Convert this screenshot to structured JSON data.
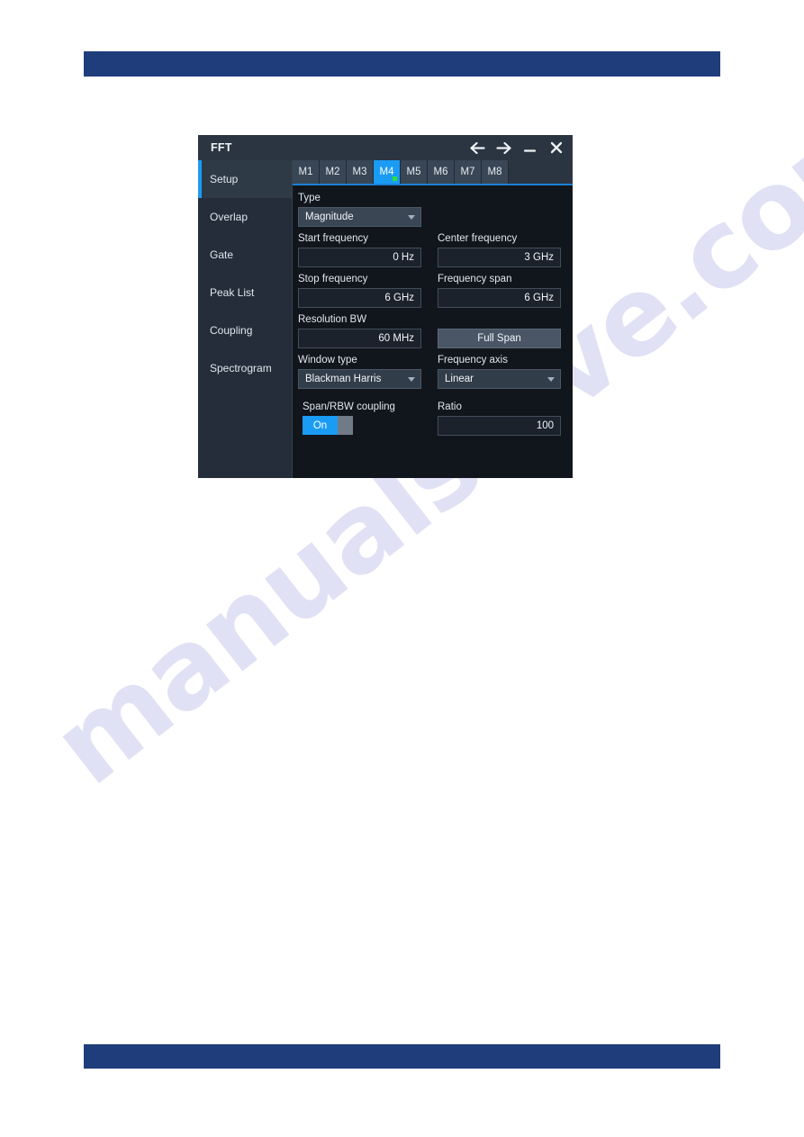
{
  "page": {
    "watermark": "manualshive.com",
    "header_bar_color": "#1f3d7a",
    "footer_bar_color": "#1f3d7a"
  },
  "dialog": {
    "title": "FFT",
    "accent_color": "#1a9cf5",
    "titlebar_actions": [
      {
        "name": "back-icon",
        "label": "Back"
      },
      {
        "name": "forward-icon",
        "label": "Forward"
      },
      {
        "name": "minimize-icon",
        "label": "Minimize"
      },
      {
        "name": "close-icon",
        "label": "Close"
      }
    ],
    "sidebar": {
      "items": [
        {
          "label": "Setup",
          "active": true
        },
        {
          "label": "Overlap",
          "active": false
        },
        {
          "label": "Gate",
          "active": false
        },
        {
          "label": "Peak List",
          "active": false
        },
        {
          "label": "Coupling",
          "active": false
        },
        {
          "label": "Spectrogram",
          "active": false
        }
      ]
    },
    "tabs": [
      {
        "label": "M1",
        "active": false
      },
      {
        "label": "M2",
        "active": false
      },
      {
        "label": "M3",
        "active": false
      },
      {
        "label": "M4",
        "active": true
      },
      {
        "label": "M5",
        "active": false
      },
      {
        "label": "M6",
        "active": false
      },
      {
        "label": "M7",
        "active": false
      },
      {
        "label": "M8",
        "active": false
      }
    ],
    "form": {
      "type": {
        "label": "Type",
        "value": "Magnitude"
      },
      "start_frequency": {
        "label": "Start frequency",
        "value": "0 Hz"
      },
      "center_frequency": {
        "label": "Center frequency",
        "value": "3 GHz"
      },
      "stop_frequency": {
        "label": "Stop frequency",
        "value": "6 GHz"
      },
      "frequency_span": {
        "label": "Frequency span",
        "value": "6 GHz"
      },
      "resolution_bw": {
        "label": "Resolution BW",
        "value": "60 MHz"
      },
      "full_span": {
        "label": "Full Span"
      },
      "window_type": {
        "label": "Window type",
        "value": "Blackman Harris"
      },
      "frequency_axis": {
        "label": "Frequency axis",
        "value": "Linear"
      },
      "span_rbw_coupling": {
        "label": "Span/RBW coupling",
        "value": "On"
      },
      "ratio": {
        "label": "Ratio",
        "value": "100"
      }
    }
  }
}
